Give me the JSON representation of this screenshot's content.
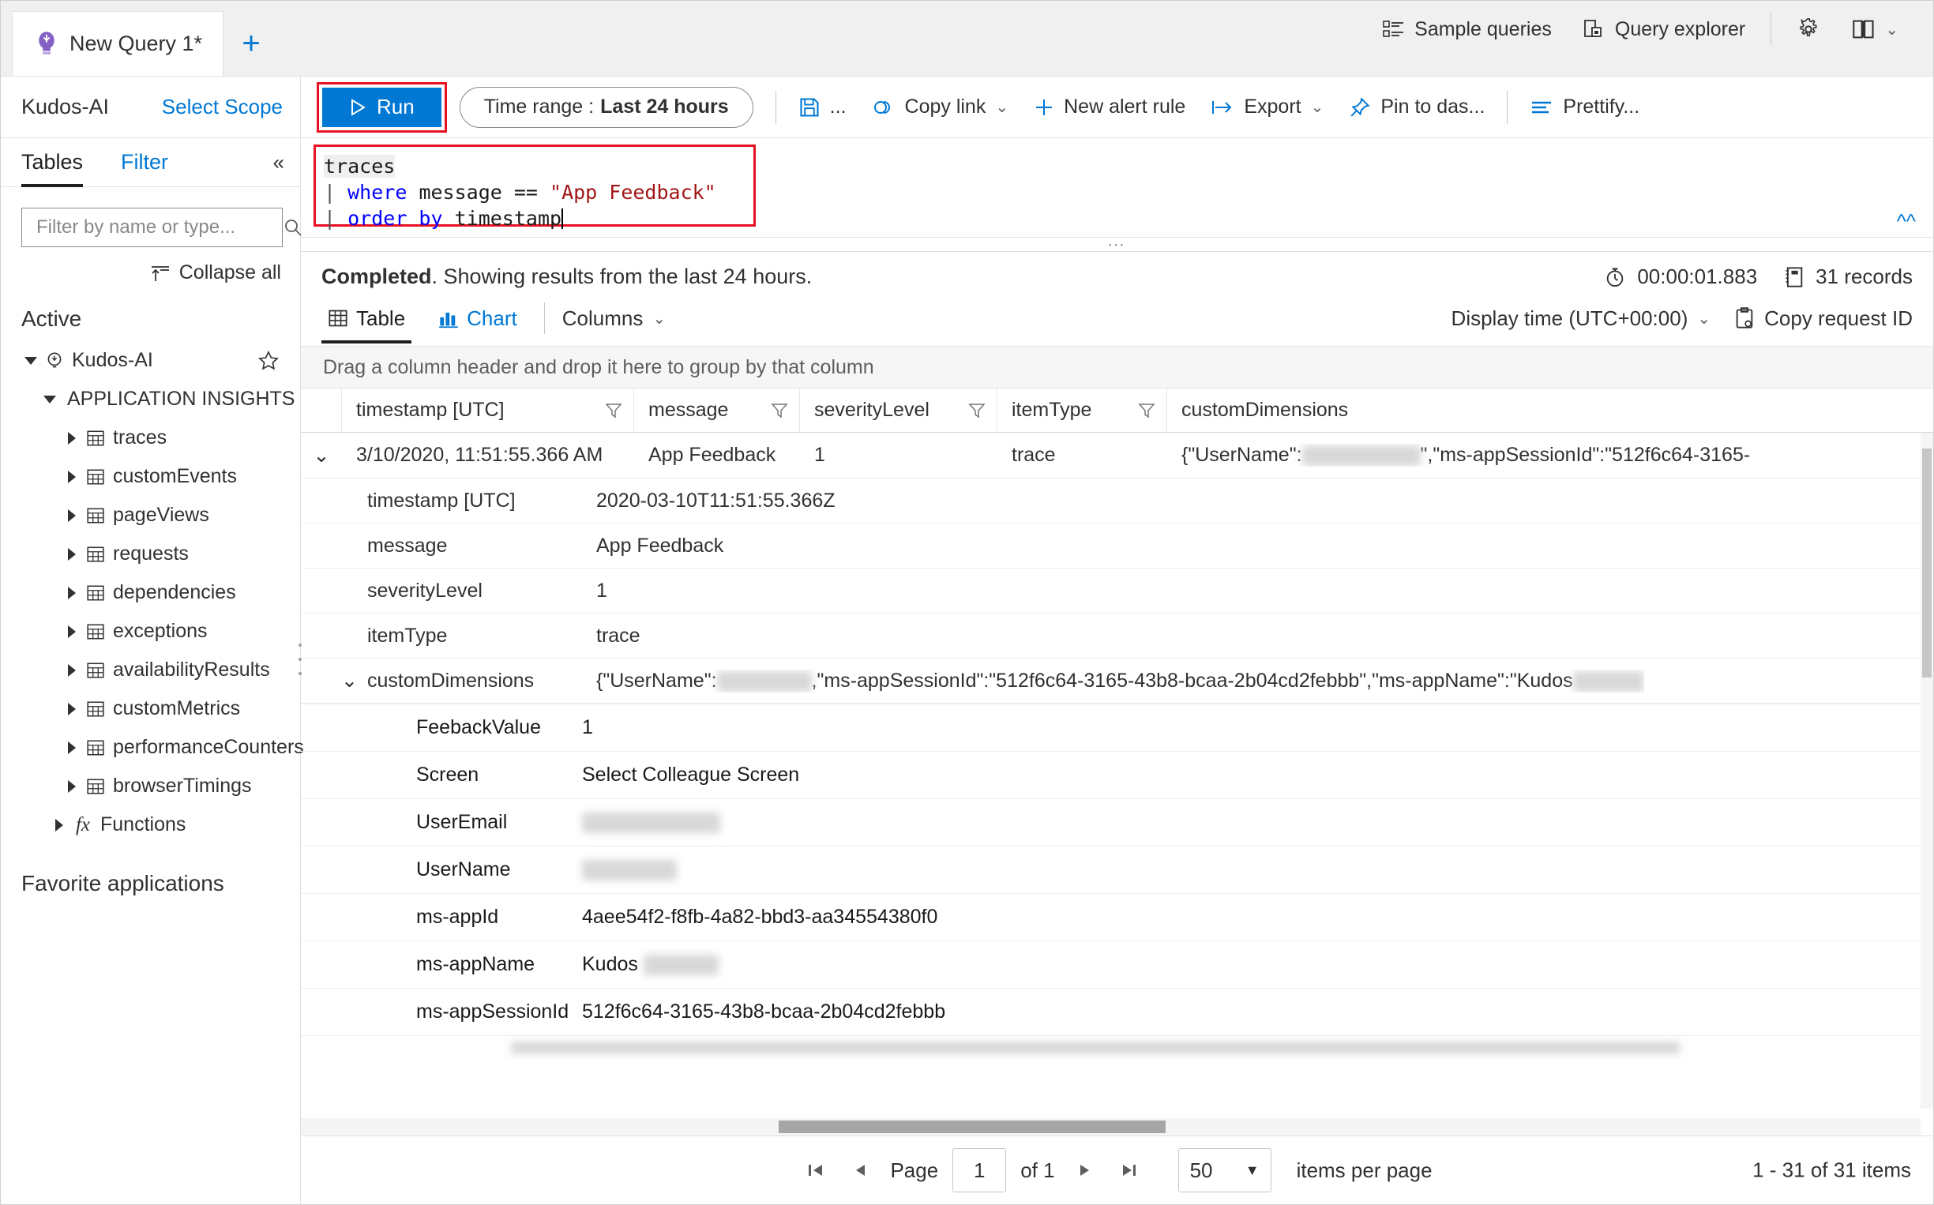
{
  "tabs": {
    "query_tab_label": "New Query 1*",
    "new_tab_label": "+",
    "bulb_icon": "bulb-icon"
  },
  "top_nav": {
    "sample_queries": "Sample queries",
    "query_explorer": "Query explorer",
    "settings_icon": "gear-icon",
    "help_icon": "book-icon",
    "chevron": "⌄"
  },
  "scope": {
    "app_name": "Kudos-AI",
    "select_scope": "Select Scope"
  },
  "command_bar": {
    "run": "Run",
    "run_icon": "play-icon",
    "time_range_label": "Time range :",
    "time_range_value": "Last 24 hours",
    "save_icon": "save-icon",
    "save_ellipsis": "...",
    "copy_link": "Copy link",
    "new_alert_rule": "New alert rule",
    "export": "Export",
    "pin_to_dashboard": "Pin to das...",
    "prettify": "Prettify...",
    "chevron": "⌄"
  },
  "left_pane": {
    "tab_tables": "Tables",
    "tab_filter": "Filter",
    "collapse_pane_icon": "double-chevron-left-icon",
    "filter_placeholder": "Filter by name or type...",
    "search_icon": "search-icon",
    "collapse_all": "Collapse all",
    "active_label": "Active",
    "root": "Kudos-AI",
    "group": "APPLICATION INSIGHTS",
    "tables": [
      "traces",
      "customEvents",
      "pageViews",
      "requests",
      "dependencies",
      "exceptions",
      "availabilityResults",
      "customMetrics",
      "performanceCounters",
      "browserTimings"
    ],
    "functions": "Functions",
    "favorite_applications": "Favorite applications"
  },
  "editor": {
    "line1": "traces",
    "line2_pipe": "|",
    "line2_kw": "where",
    "line2_field": " message == ",
    "line2_str": "\"App Feedback\"",
    "line3_pipe": "|",
    "line3_kw": "order by",
    "line3_field": " timestamp",
    "collapse_icon": "double-chevron-up-icon"
  },
  "results": {
    "status_bold": "Completed",
    "status_rest": ". Showing results from the last 24 hours.",
    "duration": "00:00:01.883",
    "duration_icon": "timer-icon",
    "records": "31 records",
    "records_icon": "records-icon",
    "tab_table": "Table",
    "tab_chart": "Chart",
    "columns": "Columns",
    "display_time": "Display time (UTC+00:00)",
    "copy_request_id": "Copy request ID",
    "group_hint": "Drag a column header and drop it here to group by that column",
    "columns_headers": [
      "timestamp [UTC]",
      "message",
      "severityLevel",
      "itemType",
      "customDimensions"
    ],
    "row": {
      "timestamp": "3/10/2020, 11:51:55.366 AM",
      "message": "App Feedback",
      "severityLevel": "1",
      "itemType": "trace",
      "customDimensions_preview_start": "{\"UserName\":",
      "customDimensions_preview_end": "\",\"ms-appSessionId\":\"512f6c64-3165-"
    },
    "detail_rows": [
      {
        "key": "timestamp [UTC]",
        "value": "2020-03-10T11:51:55.366Z"
      },
      {
        "key": "message",
        "value": "App Feedback"
      },
      {
        "key": "severityLevel",
        "value": "1"
      },
      {
        "key": "itemType",
        "value": "trace"
      }
    ],
    "custom_dimensions": {
      "key": "customDimensions",
      "value_start": "{\"UserName\":",
      "value_mid": ",\"ms-appSessionId\":\"512f6c64-3165-43b8-bcaa-2b04cd2febbb\",\"ms-appName\":\"Kudos",
      "sub_rows": [
        {
          "key": "FeebackValue",
          "value": "1",
          "redacted": false
        },
        {
          "key": "Screen",
          "value": "Select Colleague Screen",
          "redacted": false
        },
        {
          "key": "UserEmail",
          "value": "",
          "redacted": true,
          "redact_width": 170
        },
        {
          "key": "UserName",
          "value": "",
          "redacted": true,
          "redact_width": 120
        },
        {
          "key": "ms-appId",
          "value": "4aee54f2-f8fb-4a82-bbd3-aa34554380f0",
          "redacted": false
        },
        {
          "key": "ms-appName",
          "value": "Kudos",
          "redacted": true,
          "redact_width": 100
        },
        {
          "key": "ms-appSessionId",
          "value": "512f6c64-3165-43b8-bcaa-2b04cd2febbb",
          "redacted": false
        }
      ]
    }
  },
  "footer": {
    "first_page_icon": "first-page-icon",
    "prev_page_icon": "prev-page-icon",
    "page_label": "Page",
    "page_value": "1",
    "of_label": "of 1",
    "next_page_icon": "next-page-icon",
    "last_page_icon": "last-page-icon",
    "items_per_page_value": "50",
    "items_per_page_label": "items per page",
    "item_count": "1 - 31 of 31 items"
  },
  "colors": {
    "accent": "#0078d4",
    "highlight_border": "#e81123",
    "text": "#323130",
    "string_literal": "#a31515",
    "keyword": "#0000ff"
  }
}
